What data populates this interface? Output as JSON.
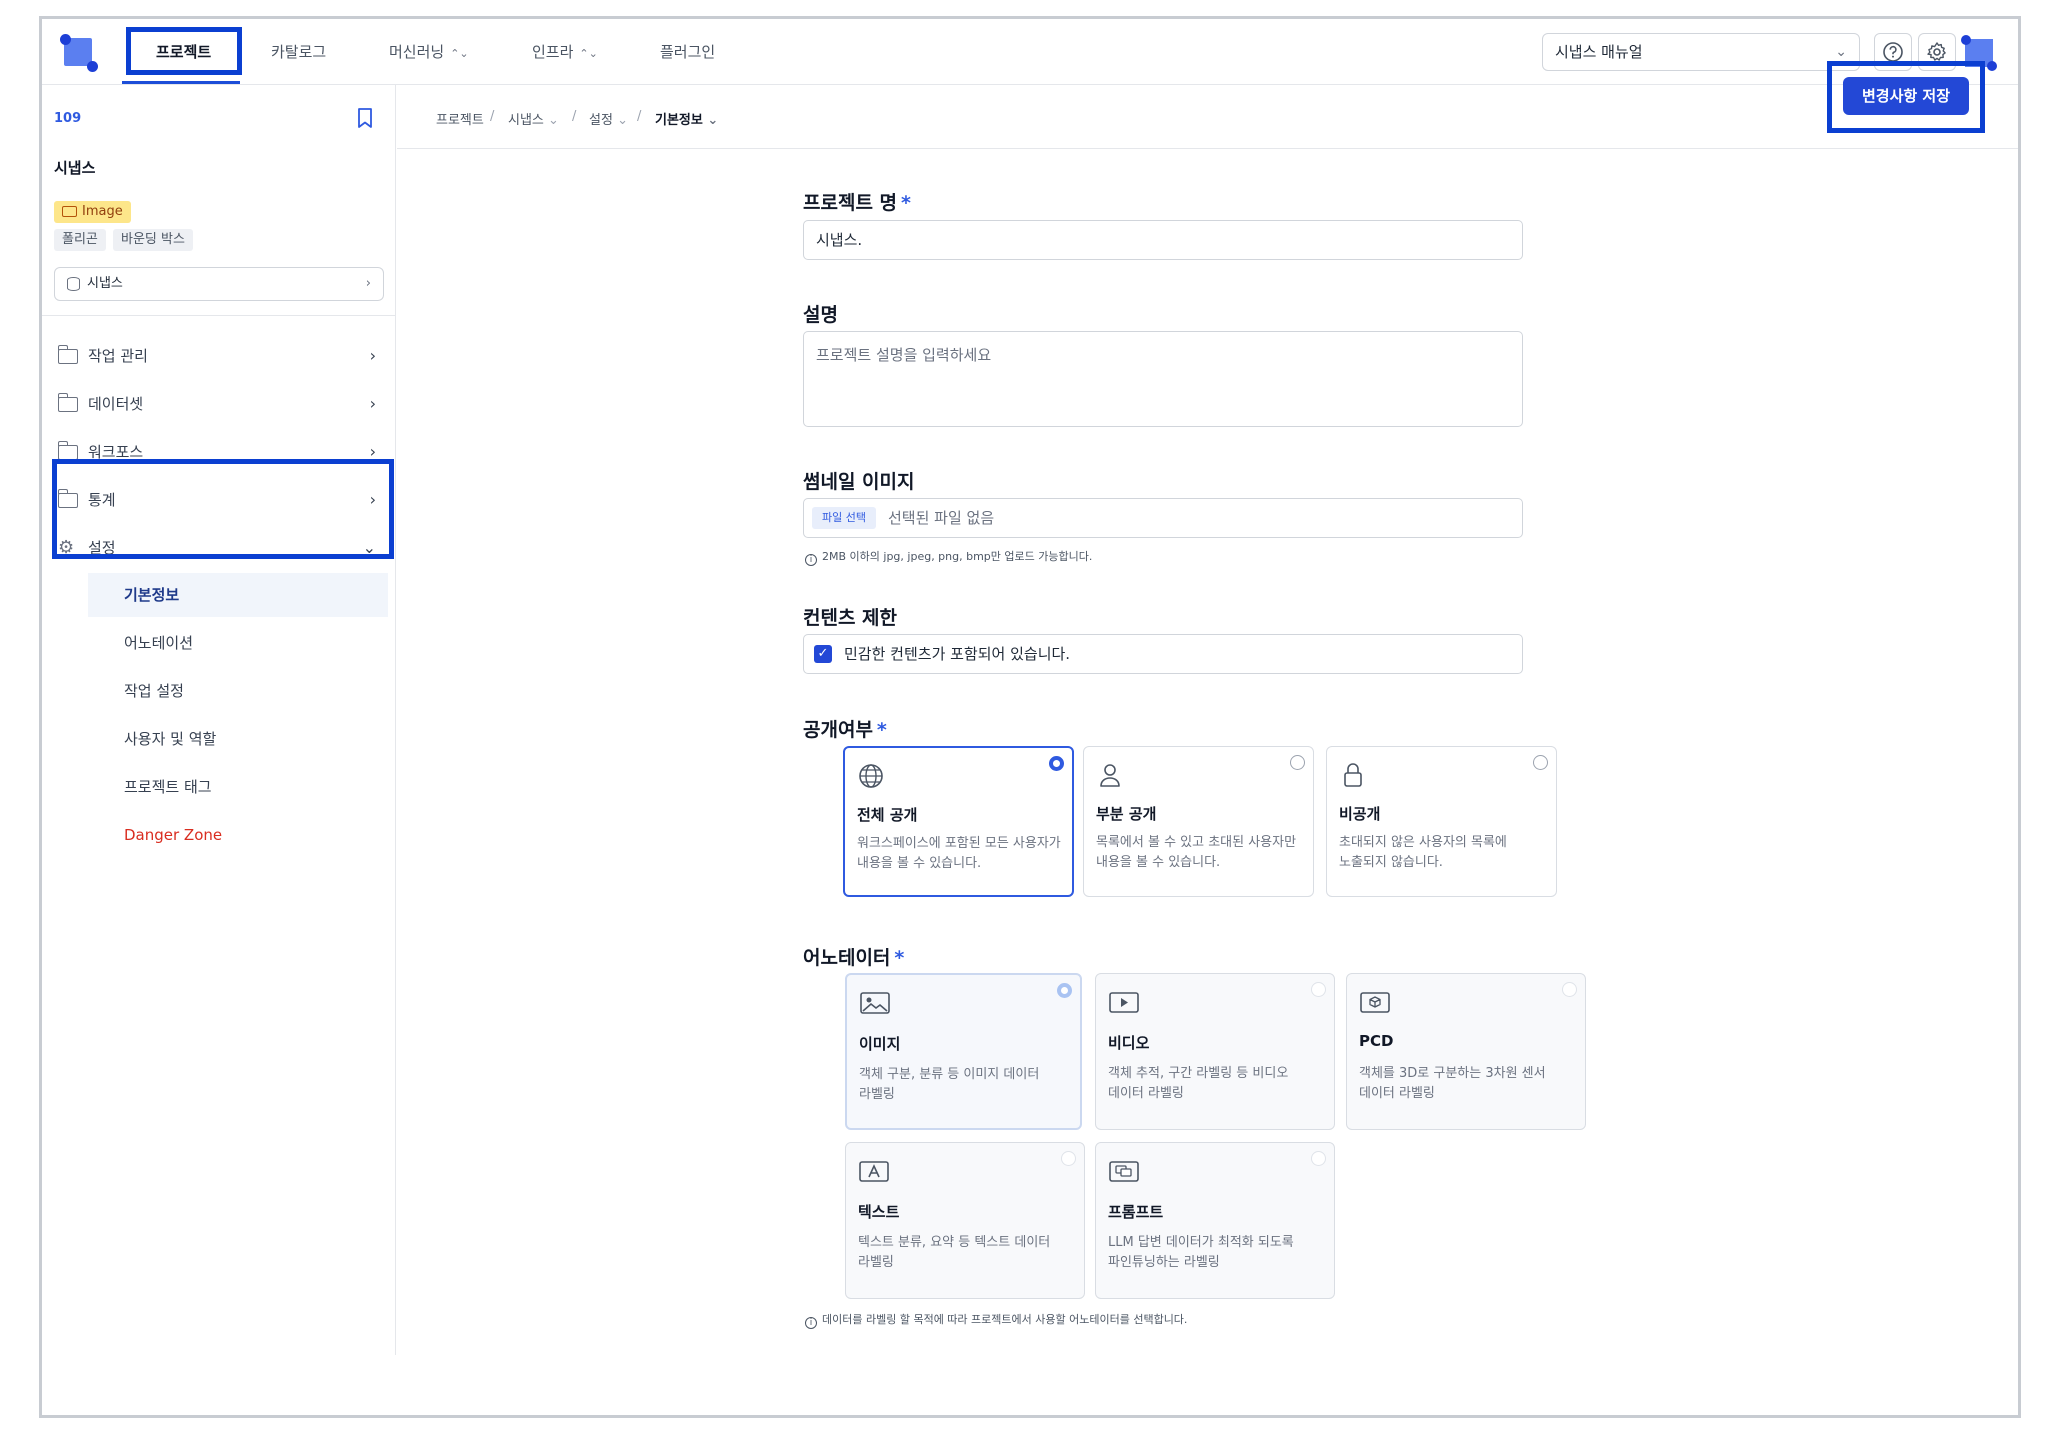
{
  "nav": {
    "tabs": [
      {
        "label": "프로젝트"
      },
      {
        "label": "카탈로그"
      },
      {
        "label": "머신러닝"
      },
      {
        "label": "인프라"
      },
      {
        "label": "플러그인"
      }
    ],
    "manual_select": "시냅스 매뉴얼"
  },
  "sidebar": {
    "project_id": "109",
    "project_name": "시냅스",
    "type_badge": "Image",
    "tags": [
      "폴리곤",
      "바운딩 박스"
    ],
    "dataset": "시냅스",
    "items": [
      {
        "label": "작업 관리"
      },
      {
        "label": "데이터셋"
      },
      {
        "label": "워크포스"
      },
      {
        "label": "통계"
      },
      {
        "label": "설정"
      }
    ],
    "sub_items": [
      {
        "label": "기본정보"
      },
      {
        "label": "어노테이션"
      },
      {
        "label": "작업 설정"
      },
      {
        "label": "사용자 및 역할"
      },
      {
        "label": "프로젝트 태그"
      },
      {
        "label": "Danger Zone"
      }
    ]
  },
  "breadcrumb": [
    "프로젝트",
    "시냅스",
    "설정",
    "기본정보"
  ],
  "save_button": "변경사항 저장",
  "form": {
    "project_name": {
      "label": "프로젝트 명",
      "value": "시냅스."
    },
    "description": {
      "label": "설명",
      "placeholder": "프로젝트 설명을 입력하세요"
    },
    "thumbnail": {
      "label": "썸네일 이미지",
      "button": "파일 선택",
      "status": "선택된 파일 없음",
      "hint": "2MB 이하의 jpg, jpeg, png, bmp만 업로드 가능합니다."
    },
    "content_limit": {
      "label": "컨텐츠 제한",
      "checkbox": "민감한 컨텐츠가 포함되어 있습니다.",
      "checked": true
    },
    "visibility": {
      "label": "공개여부",
      "options": [
        {
          "title": "전체 공개",
          "desc1": "워크스페이스에 포함된 모든 사용자가",
          "desc2": "내용을 볼 수 있습니다.",
          "icon": "globe-icon",
          "selected": true
        },
        {
          "title": "부분 공개",
          "desc1": "목록에서 볼 수 있고 초대된 사용자만",
          "desc2": "내용을 볼 수 있습니다.",
          "icon": "user-icon",
          "selected": false
        },
        {
          "title": "비공개",
          "desc1": "초대되지 않은 사용자의 목록에",
          "desc2": "노출되지 않습니다.",
          "icon": "lock-icon",
          "selected": false
        }
      ]
    },
    "annotator": {
      "label": "어노테이터",
      "options": [
        {
          "title": "이미지",
          "desc1": "객체 구분, 분류 등 이미지 데이터",
          "desc2": "라벨링",
          "icon": "image-icon",
          "selected": true
        },
        {
          "title": "비디오",
          "desc1": "객체 추적, 구간 라벨링 등 비디오",
          "desc2": "데이터 라벨링",
          "icon": "video-icon",
          "selected": false
        },
        {
          "title": "PCD",
          "desc1": "객체를 3D로 구분하는 3차원 센서",
          "desc2": "데이터 라벨링",
          "icon": "cube-icon",
          "selected": false
        },
        {
          "title": "텍스트",
          "desc1": "텍스트 분류, 요약 등 텍스트 데이터",
          "desc2": "라벨링",
          "icon": "text-icon",
          "selected": false
        },
        {
          "title": "프롬프트",
          "desc1": "LLM 답변 데이터가 최적화 되도록",
          "desc2": "파인튜닝하는 라벨링",
          "icon": "prompt-icon",
          "selected": false
        }
      ],
      "hint": "데이터를 라벨링 할 목적에 따라 프로젝트에서 사용할 어노테이터를 선택합니다."
    }
  },
  "colors": {
    "accent": "#2348d6",
    "highlight": "#0b3fd1",
    "danger": "#d92d20"
  }
}
